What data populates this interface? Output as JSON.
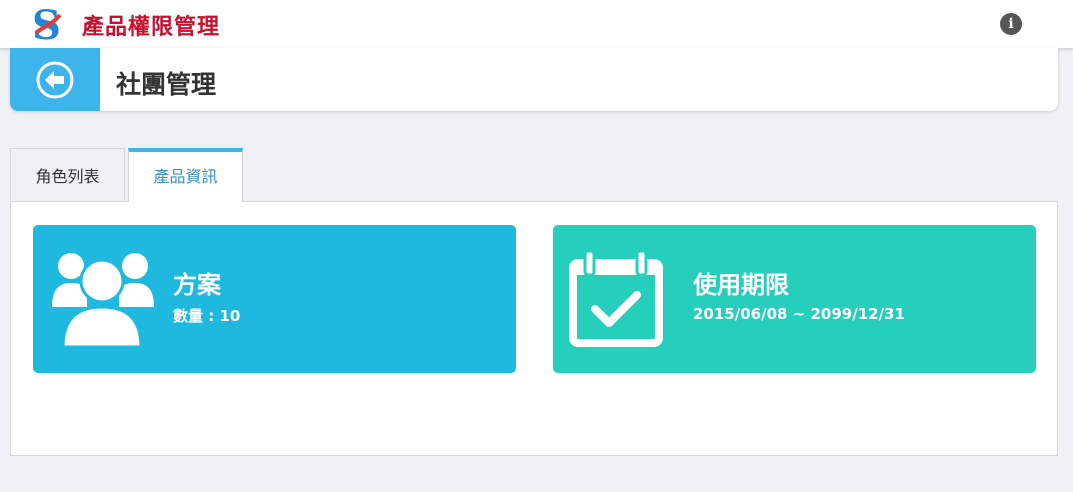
{
  "app": {
    "title": "產品權限管理",
    "logo_letter": "S"
  },
  "header": {
    "title": "社團管理"
  },
  "tabs": [
    {
      "label": "角色列表",
      "active": false
    },
    {
      "label": "產品資訊",
      "active": true
    }
  ],
  "cards": {
    "plan": {
      "title": "方案",
      "detail": "數量 : 10",
      "color": "#1fb9df",
      "icon": "users-icon"
    },
    "period": {
      "title": "使用期限",
      "detail": "2015/06/08 ~ 2099/12/31",
      "color": "#26cfbb",
      "icon": "calendar-check-icon"
    }
  },
  "colors": {
    "accent": "#3db5ea",
    "brand": "#c8102e"
  }
}
